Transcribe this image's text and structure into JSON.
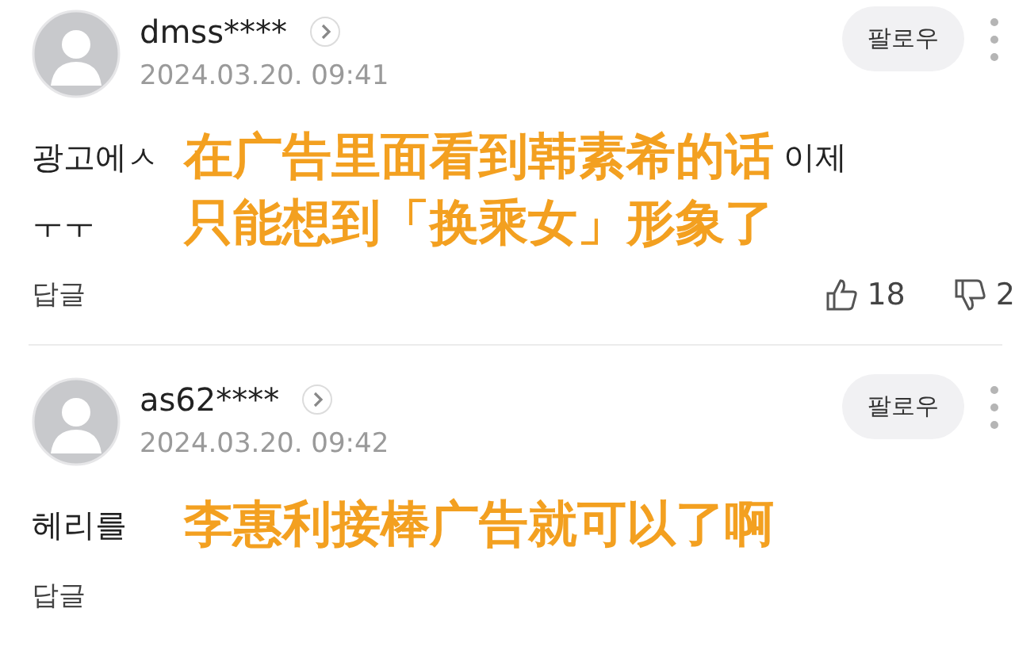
{
  "comments": [
    {
      "username": "dmss****",
      "date": "2024.03.20. 09:41",
      "follow_label": "팔로우",
      "body_left": [
        "광고에ㅅ",
        "ㅜㅜ"
      ],
      "body_right": [
        "이제"
      ],
      "caption": [
        "在广告里面看到韩素希的话",
        "只能想到「换乘女」形象了"
      ],
      "reply_label": "답글",
      "likes": "18",
      "dislikes": "2"
    },
    {
      "username": "as62****",
      "date": "2024.03.20. 09:42",
      "follow_label": "팔로우",
      "body_left": [
        "헤리를"
      ],
      "caption": [
        "李惠利接棒广告就可以了啊"
      ],
      "reply_label": "답글"
    }
  ]
}
